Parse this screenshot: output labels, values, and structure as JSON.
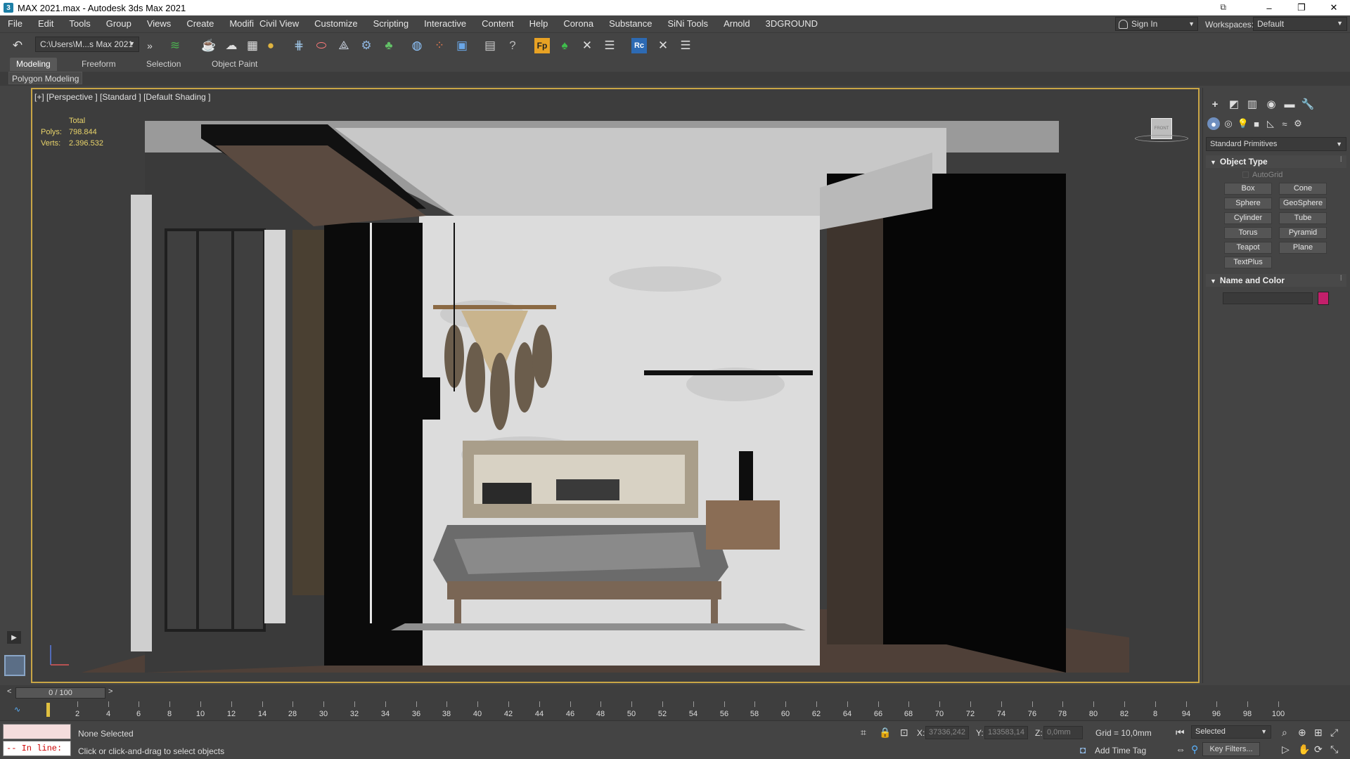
{
  "window": {
    "title": "MAX 2021.max - Autodesk 3ds Max 2021",
    "app_icon": "3",
    "controls": [
      "–",
      "❐",
      "✕"
    ]
  },
  "menu": [
    "File",
    "Edit",
    "Tools",
    "Group",
    "Views",
    "Create",
    "Modifi",
    "Civil View",
    "Customize",
    "Scripting",
    "Interactive",
    "Content",
    "Help",
    "Corona",
    "Substance",
    "SiNi Tools",
    "Arnold",
    "3DGROUND"
  ],
  "account": {
    "sign_in": "Sign In",
    "workspaces_label": "Workspaces:",
    "workspace": "Default"
  },
  "toolbar": {
    "path": "C:\\Users\\M...s Max 2021"
  },
  "ribbon": {
    "tabs": [
      "Modeling",
      "Freeform",
      "Selection",
      "Object Paint"
    ],
    "panel_label": "Polygon Modeling"
  },
  "viewport": {
    "label": "[+] [Perspective ] [Standard ] [Default Shading ]",
    "stats": {
      "header": "Total",
      "polys_label": "Polys:",
      "polys": "798.844",
      "verts_label": "Verts:",
      "verts": "2.396.532"
    },
    "viewcube_label": "FRONT"
  },
  "command_panel": {
    "dropdown": "Standard Primitives",
    "object_type_title": "Object Type",
    "autogrid": "AutoGrid",
    "primitives": [
      "Box",
      "Cone",
      "Sphere",
      "GeoSphere",
      "Cylinder",
      "Tube",
      "Torus",
      "Pyramid",
      "Teapot",
      "Plane",
      "TextPlus"
    ],
    "name_color_title": "Name and Color",
    "color": "#c31f6b"
  },
  "timeline": {
    "frame": "0 / 100",
    "ticks": [
      "2",
      "4",
      "6",
      "8",
      "10",
      "12",
      "14",
      "28",
      "30",
      "32",
      "34",
      "36",
      "38",
      "40",
      "42",
      "44",
      "46",
      "48",
      "50",
      "52",
      "54",
      "56",
      "58",
      "60",
      "62",
      "64",
      "66",
      "68",
      "70",
      "72",
      "74",
      "76",
      "78",
      "80",
      "82",
      "8",
      "94",
      "96",
      "98",
      "100"
    ]
  },
  "status": {
    "selection": "None Selected",
    "prompt": "Click or click-and-drag to select objects",
    "maxscript": "-- In line:",
    "x_label": "X:",
    "x": "37336,242",
    "y_label": "Y:",
    "y": "133583,14",
    "z_label": "Z:",
    "z": "0,0mm",
    "grid": "Grid = 10,0mm",
    "add_time_tag": "Add Time Tag",
    "key_mode": "Selected",
    "key_filters": "Key Filters..."
  }
}
